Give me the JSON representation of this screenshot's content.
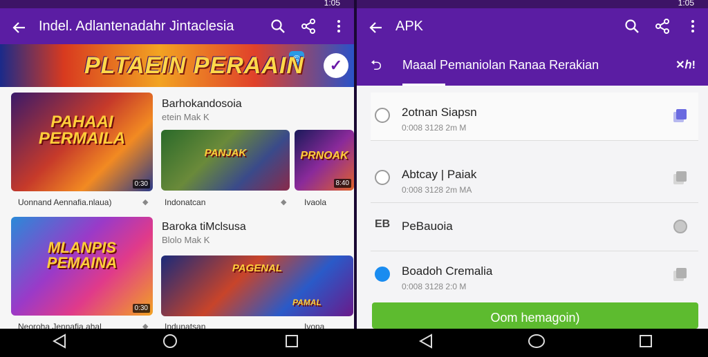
{
  "left": {
    "app_title": "Indel. Adlantenadahr Jintaclesia",
    "banner": {
      "title": "PLTAEIN PERAAIN"
    },
    "section1": {
      "title": "Barhokandosoia",
      "subtitle": "etein Mak K"
    },
    "section2": {
      "title": "Baroka tiMclsusa",
      "subtitle": "Blolo Mak K"
    },
    "cards": [
      {
        "art_text": "PAHAAI PERMAILA",
        "duration": "0:30",
        "caption": "Uonnand Aennafia.nlaua)"
      },
      {
        "art_text": "PANJAK",
        "duration": "",
        "caption": "Indonatcan"
      },
      {
        "art_text": "PRNOAK",
        "duration": "8:40",
        "caption": "Ivaola"
      },
      {
        "art_text": "MLANPIS PEMAINA",
        "duration": "0:30",
        "caption": "Neoroha Jennafia ahal"
      },
      {
        "art_text": "PAGENAL",
        "duration": "",
        "caption": "Indunatsan"
      },
      {
        "art_text": "PAMAL",
        "duration": "",
        "caption": "Ivona"
      }
    ]
  },
  "right": {
    "app_title": "APK",
    "subtitle": "Maaal Pemaniolan Ranaa Rerakian",
    "sub_icon": "✕ℎ!",
    "items": [
      {
        "prefix": "",
        "name": "2otnan Siapsn",
        "meta": "0:008 3128 2m M"
      },
      {
        "prefix": "",
        "name": "Abtcay | Paiak",
        "meta": "0:008 3128 2m MA"
      },
      {
        "prefix": "EB",
        "name": "PeBauoia",
        "meta": ""
      },
      {
        "prefix": "",
        "name": "Boadoh Cremalia",
        "meta": "0:008 3128 2:0 M"
      }
    ],
    "button_label": "Oom hemagoin)"
  },
  "status": {
    "clock": "1:05"
  },
  "colors": {
    "appbar": "#5b1da3",
    "accent_blue": "#1a8cf0",
    "green": "#5dbb2f"
  }
}
